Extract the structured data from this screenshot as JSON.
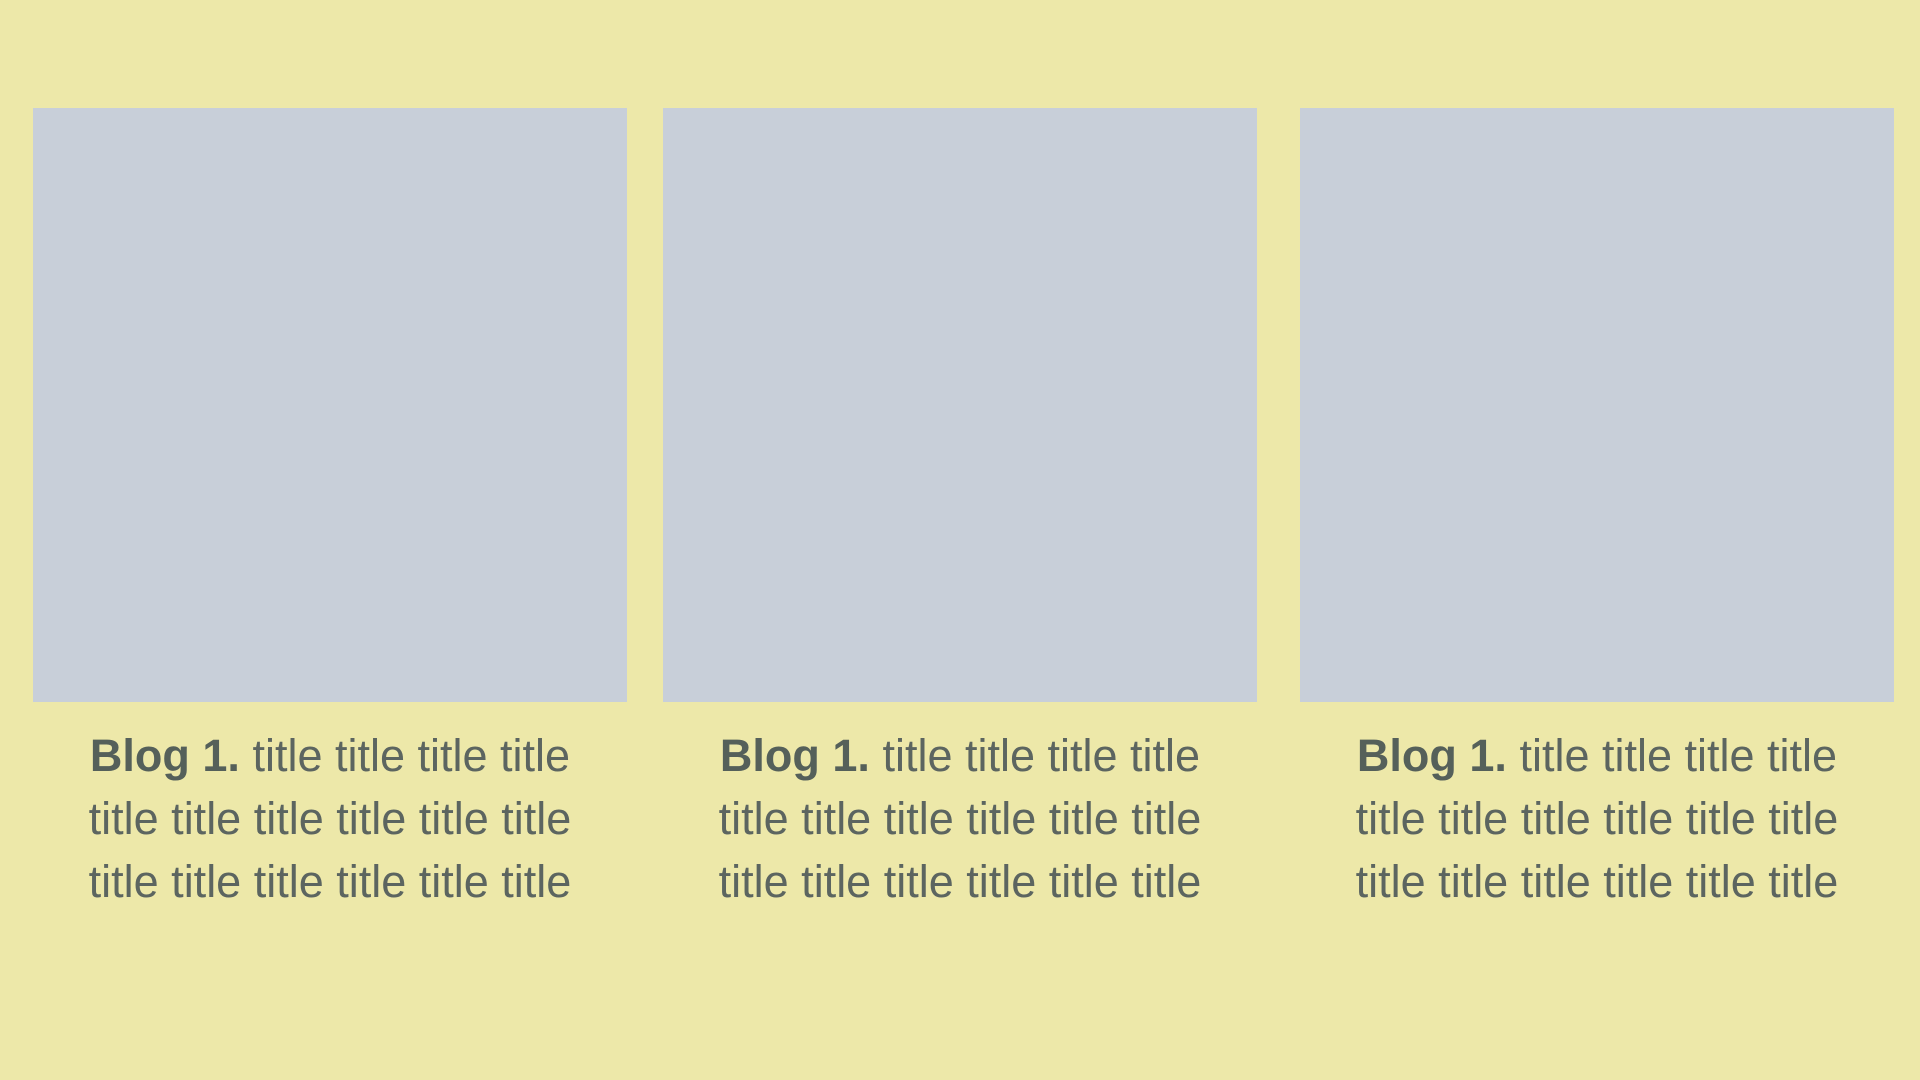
{
  "background_color": "#ede8a9",
  "placeholder_color": "#c8cfd9",
  "text_color": "#5c6560",
  "cards": [
    {
      "label": "Blog 1.",
      "title": "title title title title title title title title title title title title title title title title"
    },
    {
      "label": "Blog 1.",
      "title": "title title title title title title title title title title title title title title title title"
    },
    {
      "label": "Blog 1.",
      "title": "title title title title title title title title title title title title title title title title"
    }
  ]
}
